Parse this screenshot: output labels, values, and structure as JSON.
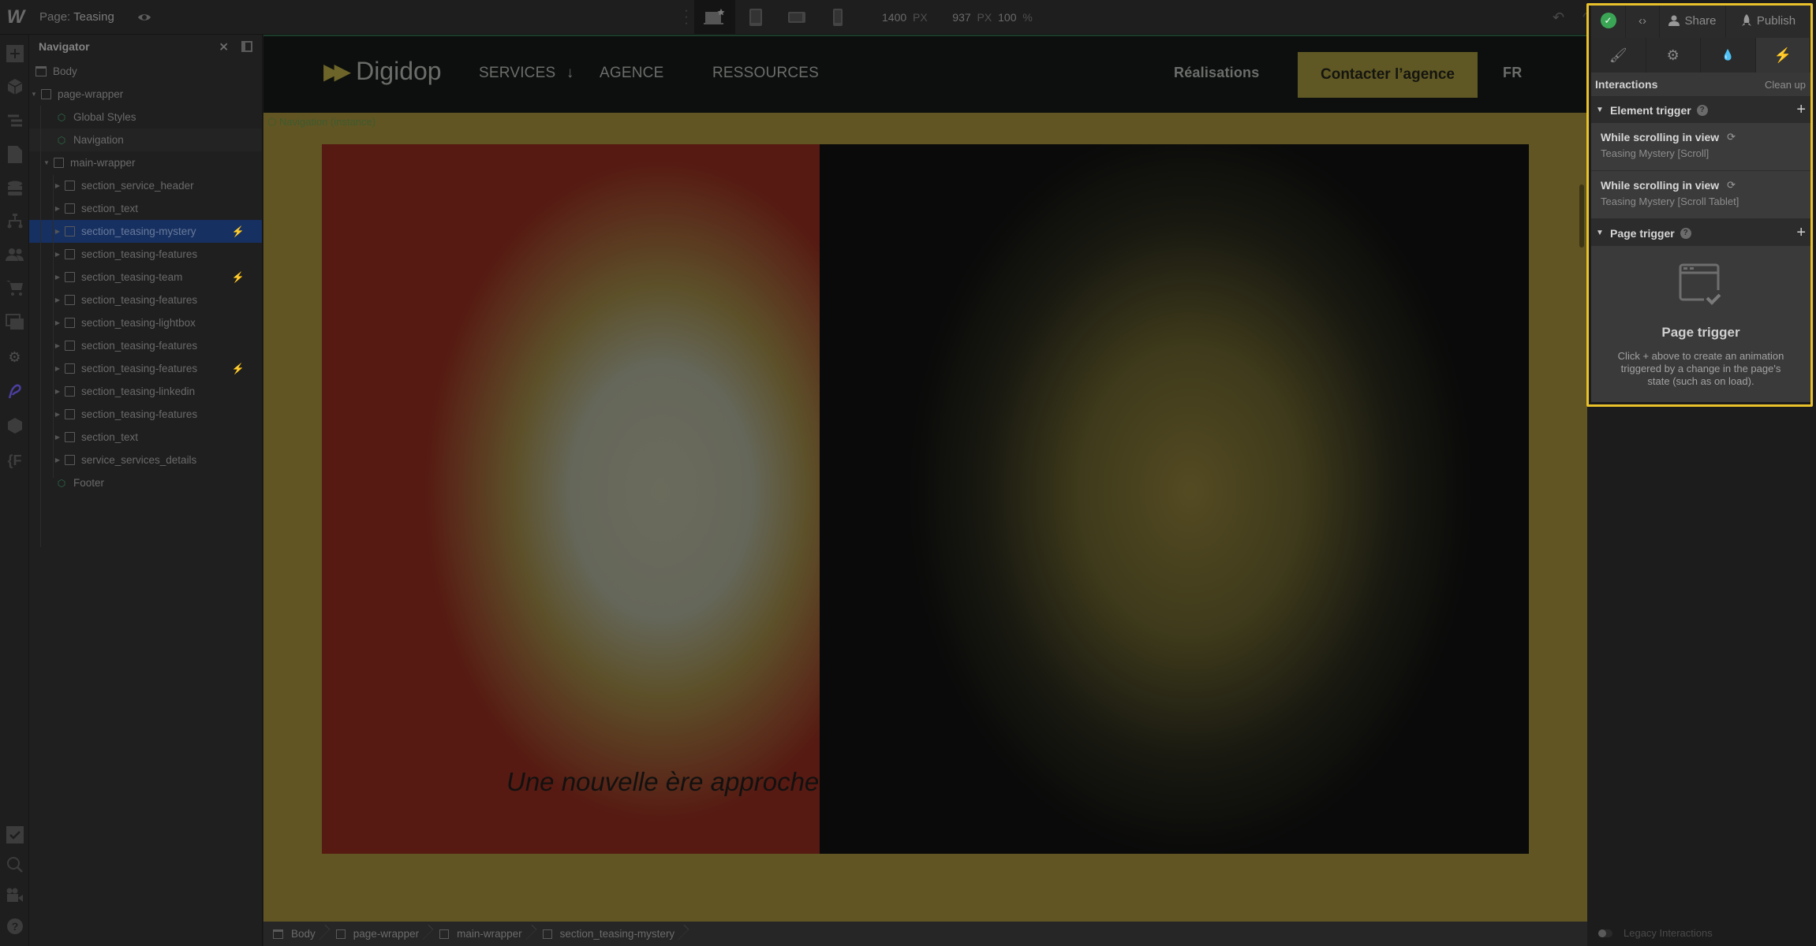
{
  "topbar": {
    "logo": "W",
    "page_prefix": "Page:",
    "page_name": "Teasing",
    "width_value": "1400",
    "width_unit": "PX",
    "height_value": "937",
    "height_unit": "PX",
    "zoom_value": "100",
    "zoom_unit": "%"
  },
  "right_header": {
    "share_label": "Share",
    "publish_label": "Publish"
  },
  "interactions": {
    "title": "Interactions",
    "cleanup_label": "Clean up",
    "element_trigger": {
      "label": "Element trigger",
      "items": [
        {
          "title": "While scrolling in view",
          "subtitle": "Teasing Mystery [Scroll]"
        },
        {
          "title": "While scrolling in view",
          "subtitle": "Teasing Mystery [Scroll Tablet]"
        }
      ]
    },
    "page_trigger": {
      "label": "Page trigger",
      "empty_title": "Page trigger",
      "empty_desc": "Click + above to create an animation triggered by a change in the page's state (such as on load)."
    },
    "legacy_label": "Legacy Interactions"
  },
  "navigator": {
    "title": "Navigator",
    "items": [
      {
        "label": "Body",
        "type": "page",
        "depth": 0
      },
      {
        "label": "page-wrapper",
        "type": "box",
        "depth": 0,
        "expanded": true
      },
      {
        "label": "Global Styles",
        "type": "component",
        "depth": 1
      },
      {
        "label": "Navigation",
        "type": "component",
        "depth": 1
      },
      {
        "label": "main-wrapper",
        "type": "box",
        "depth": 1,
        "expanded": true
      },
      {
        "label": "section_service_header",
        "type": "box",
        "depth": 2
      },
      {
        "label": "section_text",
        "type": "box",
        "depth": 2
      },
      {
        "label": "section_teasing-mystery",
        "type": "box",
        "depth": 2,
        "selected": true,
        "interaction": true
      },
      {
        "label": "section_teasing-features",
        "type": "box",
        "depth": 2
      },
      {
        "label": "section_teasing-team",
        "type": "box",
        "depth": 2,
        "interaction": true
      },
      {
        "label": "section_teasing-features",
        "type": "box",
        "depth": 2
      },
      {
        "label": "section_teasing-lightbox",
        "type": "box",
        "depth": 2
      },
      {
        "label": "section_teasing-features",
        "type": "box",
        "depth": 2
      },
      {
        "label": "section_teasing-features",
        "type": "box",
        "depth": 2,
        "interaction": true
      },
      {
        "label": "section_teasing-linkedin",
        "type": "box",
        "depth": 2
      },
      {
        "label": "section_teasing-features",
        "type": "box",
        "depth": 2
      },
      {
        "label": "section_text",
        "type": "box",
        "depth": 2
      },
      {
        "label": "service_services_details",
        "type": "box",
        "depth": 2
      },
      {
        "label": "Footer",
        "type": "component",
        "depth": 1
      }
    ]
  },
  "site": {
    "brand": "Digidop",
    "nav": {
      "services": "SERVICES",
      "services_arrow": "↓",
      "agence": "AGENCE",
      "ressources": "RESSOURCES",
      "realisations": "Réalisations",
      "cta": "Contacter l’agence",
      "lang": "FR"
    },
    "nav_instance_label": "Navigation (instance)",
    "hero_text": "Une nouvelle ère approche"
  },
  "breadcrumb": [
    {
      "label": "Body",
      "type": "page"
    },
    {
      "label": "page-wrapper",
      "type": "box"
    },
    {
      "label": "main-wrapper",
      "type": "box"
    },
    {
      "label": "section_teasing-mystery",
      "type": "box"
    }
  ],
  "colors": {
    "highlight": "#e9c12b",
    "selection": "#163061",
    "canvas_bg": "#615523",
    "cta_bg": "#5f5824",
    "success": "#3aa655"
  }
}
